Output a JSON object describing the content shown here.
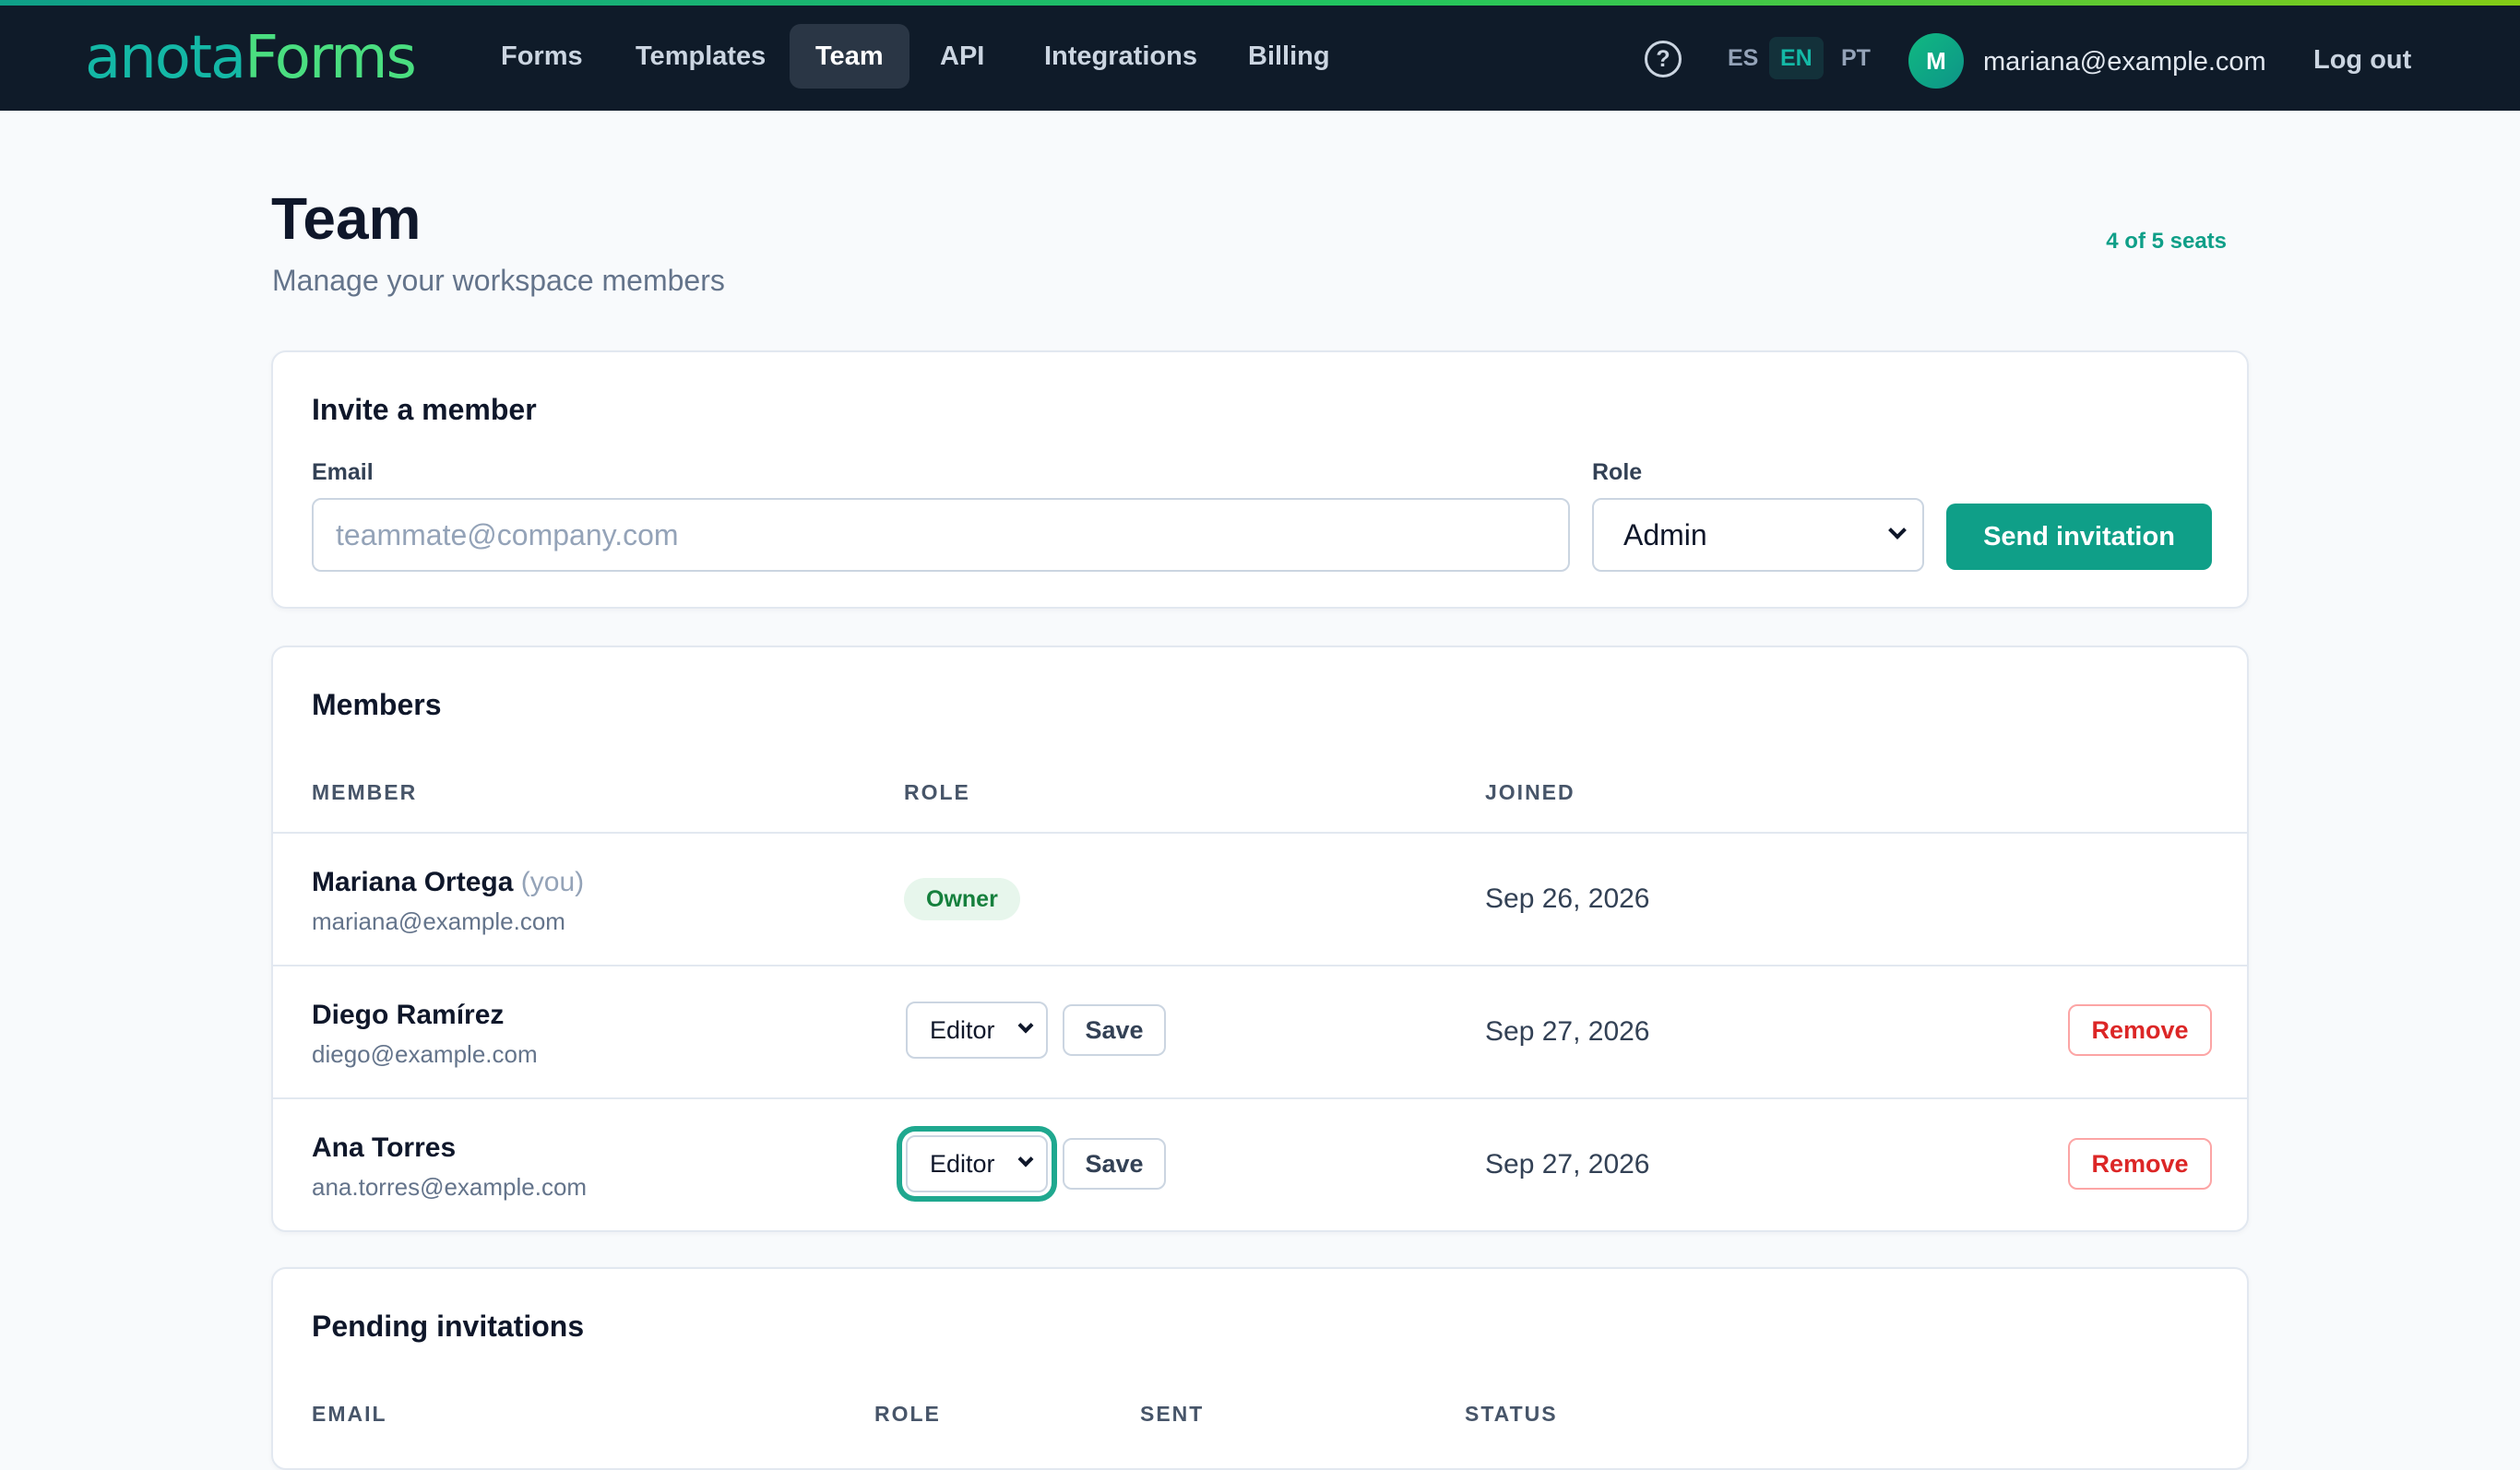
{
  "brand": {
    "logo_part1": "anota",
    "logo_part2": "Forms"
  },
  "nav": {
    "items": [
      {
        "label": "Forms",
        "active": false
      },
      {
        "label": "Templates",
        "active": false
      },
      {
        "label": "Team",
        "active": true
      },
      {
        "label": "API",
        "active": false
      },
      {
        "label": "Integrations",
        "active": false
      },
      {
        "label": "Billing",
        "active": false
      }
    ],
    "help_icon": "?",
    "languages": [
      {
        "code": "ES",
        "active": false
      },
      {
        "code": "EN",
        "active": true
      },
      {
        "code": "PT",
        "active": false
      }
    ],
    "user_initial": "M",
    "user_email": "mariana@example.com",
    "logout_label": "Log out"
  },
  "page": {
    "title": "Team",
    "subtitle": "Manage your workspace members",
    "seats": "4 of 5 seats"
  },
  "invite": {
    "title": "Invite a member",
    "email_label": "Email",
    "email_placeholder": "teammate@company.com",
    "email_value": "",
    "role_label": "Role",
    "role_value": "Admin",
    "send_label": "Send invitation"
  },
  "members": {
    "title": "Members",
    "columns": {
      "member": "MEMBER",
      "role": "ROLE",
      "joined": "JOINED"
    },
    "rows": [
      {
        "name": "Mariana Ortega",
        "you_tag": "(you)",
        "email": "mariana@example.com",
        "role": "Owner",
        "joined": "Sep 26, 2026"
      },
      {
        "name": "Diego Ramírez",
        "email": "diego@example.com",
        "role": "Editor",
        "save_label": "Save",
        "joined": "Sep 27, 2026",
        "remove_label": "Remove"
      },
      {
        "name": "Ana Torres",
        "email": "ana.torres@example.com",
        "role": "Editor",
        "save_label": "Save",
        "joined": "Sep 27, 2026",
        "remove_label": "Remove"
      }
    ]
  },
  "pending": {
    "title": "Pending invitations",
    "columns": {
      "email": "EMAIL",
      "role": "ROLE",
      "sent": "SENT",
      "status": "STATUS"
    }
  },
  "colors": {
    "accent": "#0f9f88",
    "navbar": "#0f1b29",
    "danger": "#dc2626",
    "owner_badge_bg": "#e7f6ec"
  }
}
